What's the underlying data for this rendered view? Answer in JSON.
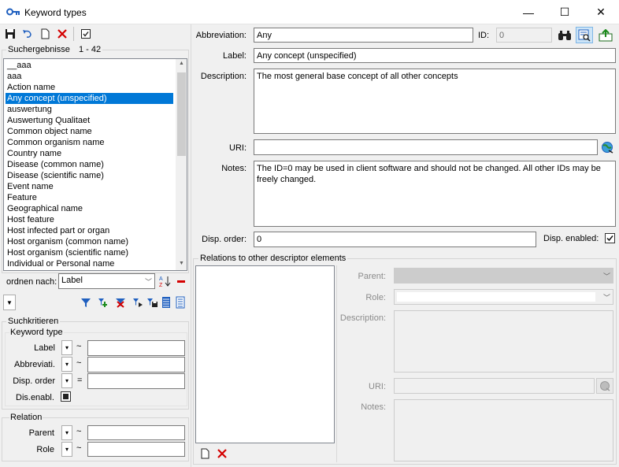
{
  "window": {
    "title": "Keyword types",
    "minimize": "—",
    "maximize": "☐",
    "close": "✕"
  },
  "colors": {
    "accent": "#0078d7",
    "delete_red": "#d40000",
    "key_blue": "#1f5fbf"
  },
  "left_panel": {
    "results_label": "Suchergebnisse",
    "results_range": "1 - 42",
    "items": [
      "__aaa",
      "aaa",
      "Action name",
      "Any concept (unspecified)",
      "auswertung",
      "Auswertung Qualitaet",
      "Common object name",
      "Common organism name",
      "Country name",
      "Disease (common name)",
      "Disease (scientific name)",
      "Event name",
      "Feature",
      "Geographical name",
      "Host feature",
      "Host infected part or organ",
      "Host organism (common name)",
      "Host organism (scientific name)",
      "Individual or Personal name"
    ],
    "selected_index": 3,
    "sort_label": "ordnen nach:",
    "sort_value": "Label",
    "search_group": "Suchkritieren",
    "keyword_group": "Keyword type",
    "filters": [
      {
        "label": "Label",
        "op": "~",
        "value": ""
      },
      {
        "label": "Abbreviati.",
        "op": "~",
        "value": ""
      },
      {
        "label": "Disp. order",
        "op": "=",
        "value": ""
      }
    ],
    "dis_enabled_label": "Dis.enabl.",
    "relation_group": "Relation",
    "relation_filters": [
      {
        "label": "Parent",
        "op": "~",
        "value": ""
      },
      {
        "label": "Role",
        "op": "~",
        "value": ""
      }
    ]
  },
  "detail": {
    "abbreviation_label": "Abbreviation:",
    "abbreviation_value": "Any",
    "id_label": "ID:",
    "id_value": "0",
    "label_label": "Label:",
    "label_value": "Any concept (unspecified)",
    "description_label": "Description:",
    "description_value": "The most general base concept of all other concepts",
    "uri_label": "URI:",
    "uri_value": "",
    "notes_label": "Notes:",
    "notes_value": "The ID=0 may be used in client software and should not be changed. All other IDs may be freely changed.",
    "disp_order_label": "Disp. order:",
    "disp_order_value": "0",
    "disp_enabled_label": "Disp. enabled:",
    "disp_enabled_checked": true
  },
  "relations": {
    "group_label": "Relations to other descriptor elements",
    "parent_label": "Parent:",
    "role_label": "Role:",
    "description_label": "Description:",
    "uri_label": "URI:",
    "notes_label": "Notes:"
  }
}
